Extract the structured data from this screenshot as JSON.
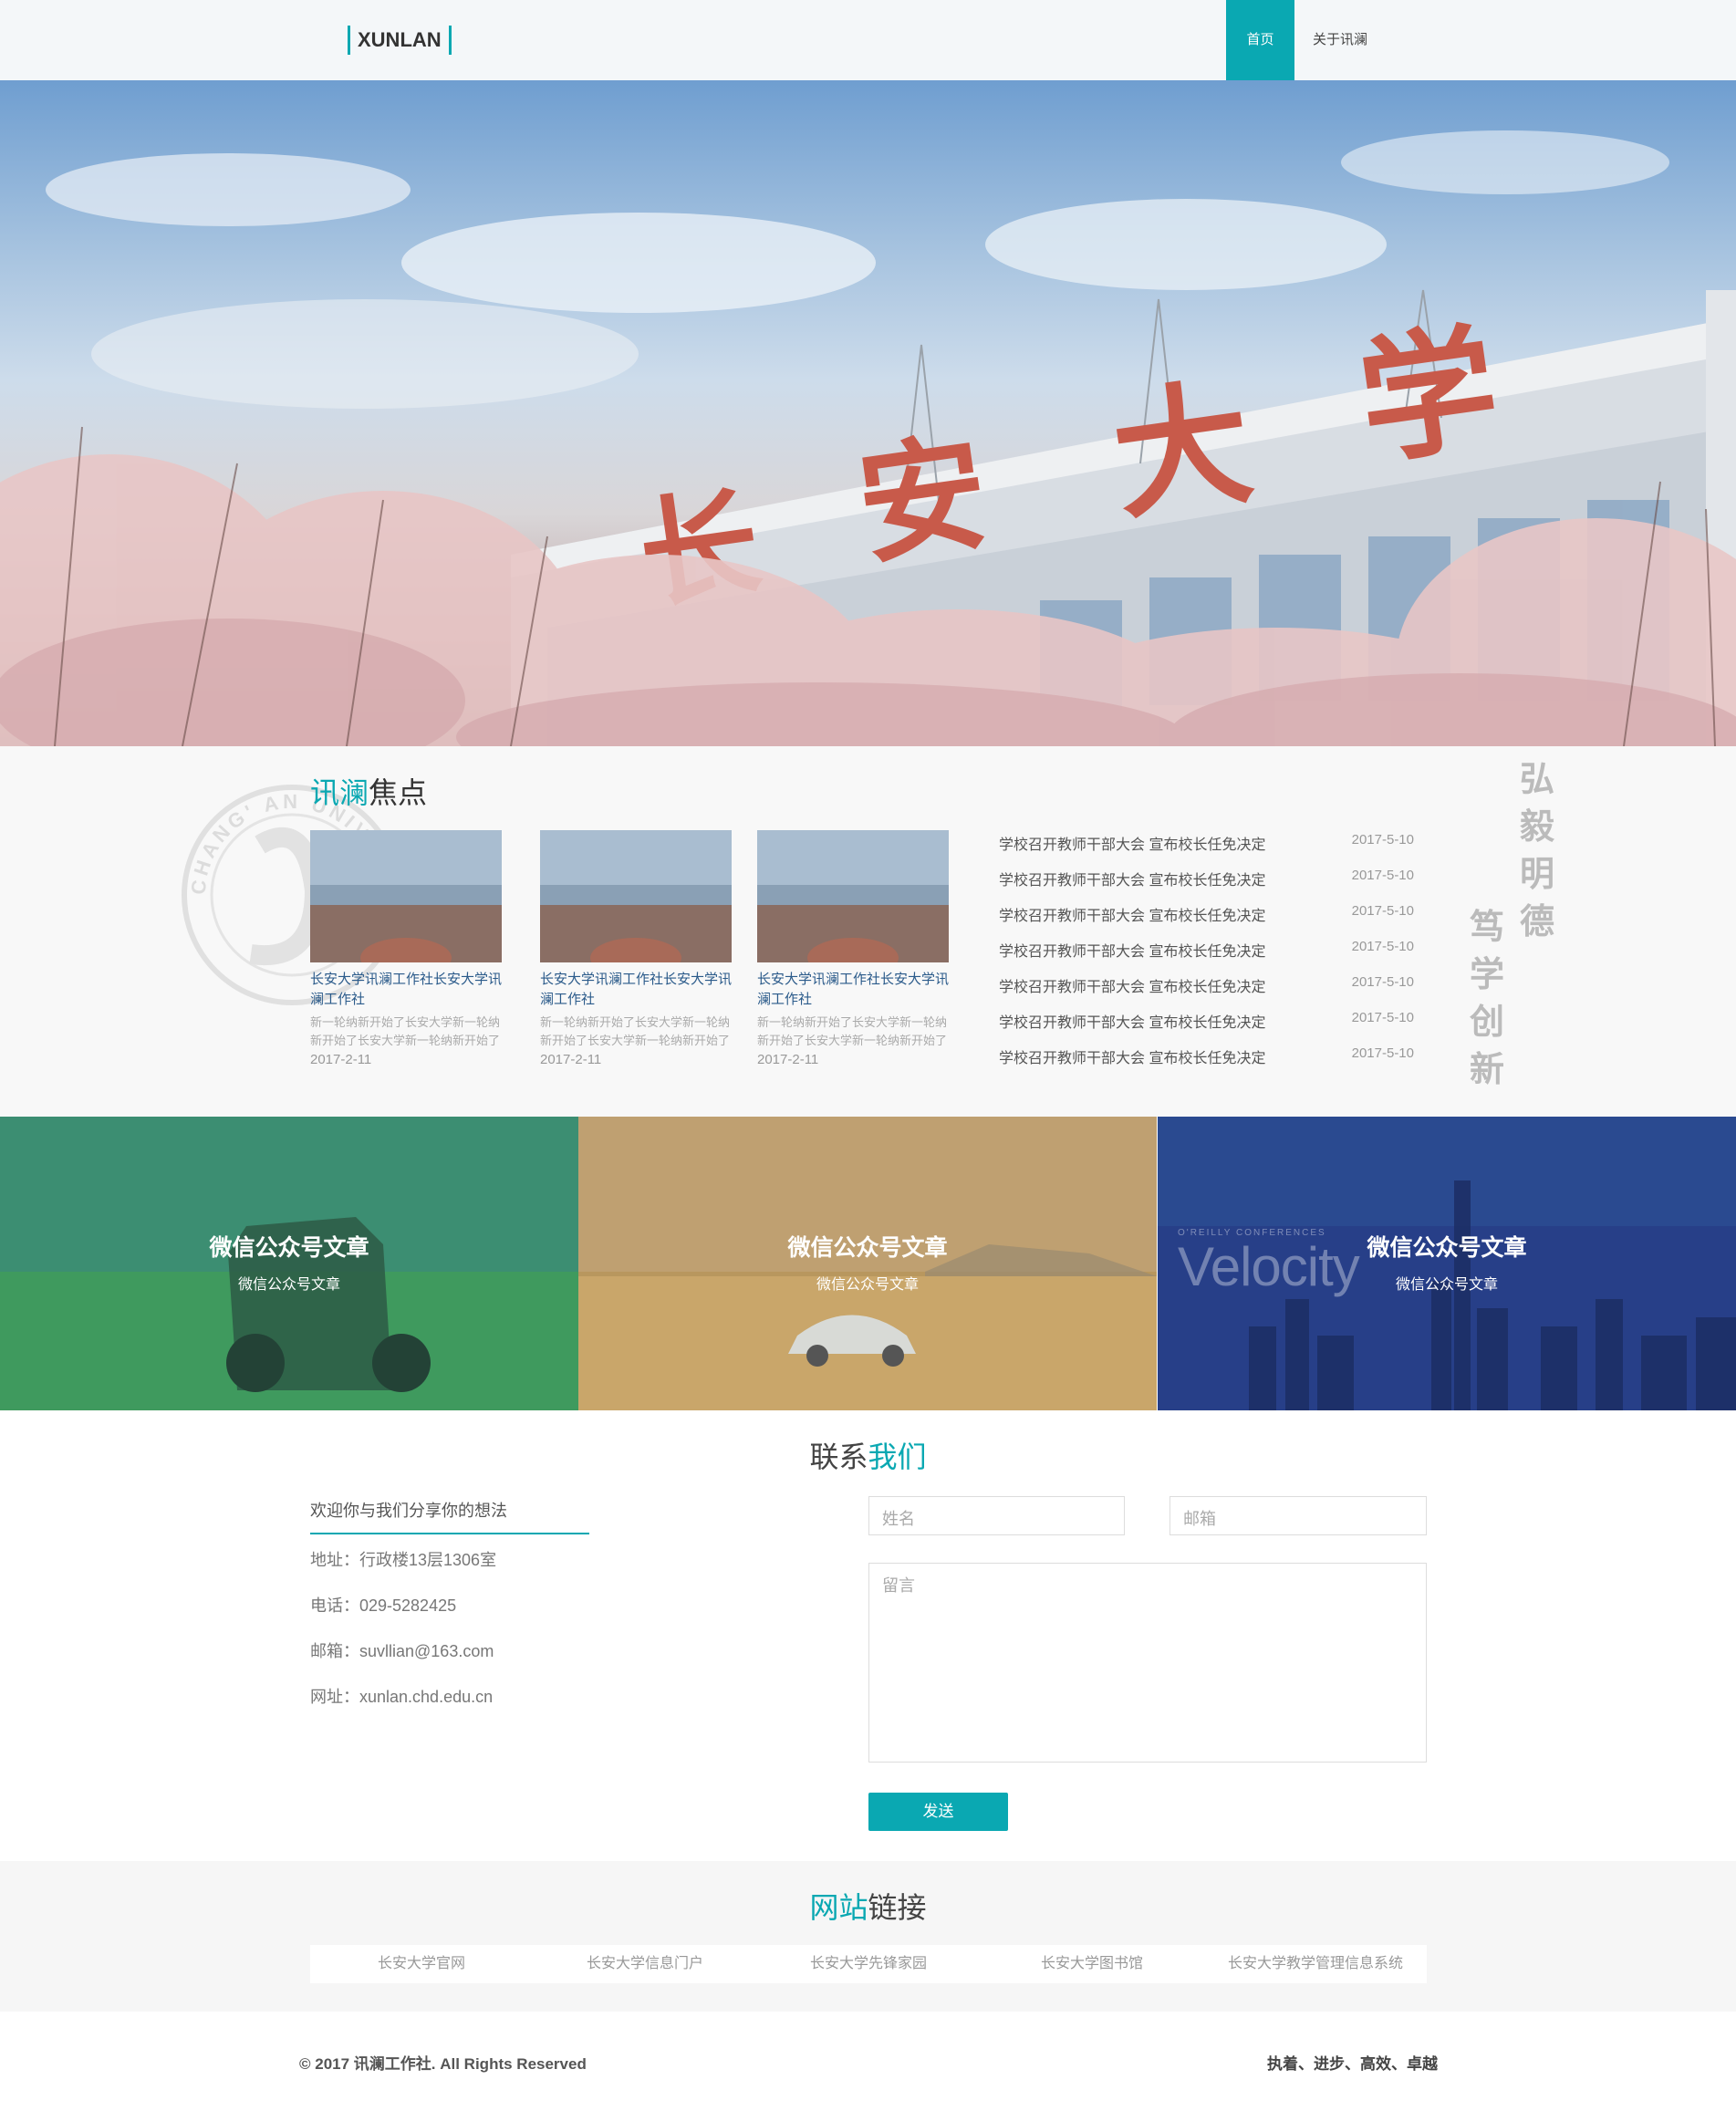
{
  "nav": {
    "logo": "XUNLAN",
    "home": "首页",
    "about": "关于讯澜"
  },
  "hero": {
    "sign_chars": [
      "长",
      "安",
      "大",
      "学"
    ]
  },
  "focus": {
    "title_accent": "讯澜",
    "title_rest": "焦点",
    "cards": [
      {
        "title": "长安大学讯澜工作社长安大学讯澜工作社",
        "desc": "新一轮纳新开始了长安大学新一轮纳新开始了长安大学新一轮纳新开始了",
        "date": "2017-2-11"
      },
      {
        "title": "长安大学讯澜工作社长安大学讯澜工作社",
        "desc": "新一轮纳新开始了长安大学新一轮纳新开始了长安大学新一轮纳新开始了",
        "date": "2017-2-11"
      },
      {
        "title": "长安大学讯澜工作社长安大学讯澜工作社",
        "desc": "新一轮纳新开始了长安大学新一轮纳新开始了长安大学新一轮纳新开始了",
        "date": "2017-2-11"
      }
    ],
    "news": [
      {
        "title": "学校召开教师干部大会 宣布校长任免决定",
        "date": "2017-5-10"
      },
      {
        "title": "学校召开教师干部大会 宣布校长任免决定",
        "date": "2017-5-10"
      },
      {
        "title": "学校召开教师干部大会 宣布校长任免决定",
        "date": "2017-5-10"
      },
      {
        "title": "学校召开教师干部大会 宣布校长任免决定",
        "date": "2017-5-10"
      },
      {
        "title": "学校召开教师干部大会 宣布校长任免决定",
        "date": "2017-5-10"
      },
      {
        "title": "学校召开教师干部大会 宣布校长任免决定",
        "date": "2017-5-10"
      },
      {
        "title": "学校召开教师干部大会 宣布校长任免决定",
        "date": "2017-5-10"
      }
    ],
    "calligraphy_1": "弘毅明德",
    "calligraphy_2": "笃学创新",
    "seal_text": "CHANG' AN UNIVERSITY"
  },
  "wechat": [
    {
      "title": "微信公众号文章",
      "sub": "微信公众号文章",
      "tint": "#2e8a66"
    },
    {
      "title": "微信公众号文章",
      "sub": "微信公众号文章",
      "tint": "#b5935c"
    },
    {
      "title": "微信公众号文章",
      "sub": "微信公众号文章",
      "tint": "#27408a"
    }
  ],
  "velocity": {
    "small": "O'REILLY CONFERENCES",
    "big": "Velocity"
  },
  "contact": {
    "title_a": "联系",
    "title_b": "我们",
    "intro": "欢迎你与我们分享你的想法",
    "address": "地址：行政楼13层1306室",
    "phone": "电话：029-5282425",
    "email": "邮箱：suvllian@163.com",
    "website": "网址：xunlan.chd.edu.cn",
    "name_placeholder": "姓名",
    "email_placeholder": "邮箱",
    "message_placeholder": "留言",
    "send": "发送"
  },
  "links": {
    "title_a": "网站",
    "title_b": "链接",
    "items": [
      "长安大学官网",
      "长安大学信息门户",
      "长安大学先锋家园",
      "长安大学图书馆",
      "长安大学教学管理信息系统"
    ]
  },
  "footer": {
    "copyright": "© 2017 讯澜工作社. All Rights Reserved",
    "motto": "执着、进步、高效、卓越"
  },
  "colors": {
    "accent": "#0aa8b2"
  }
}
